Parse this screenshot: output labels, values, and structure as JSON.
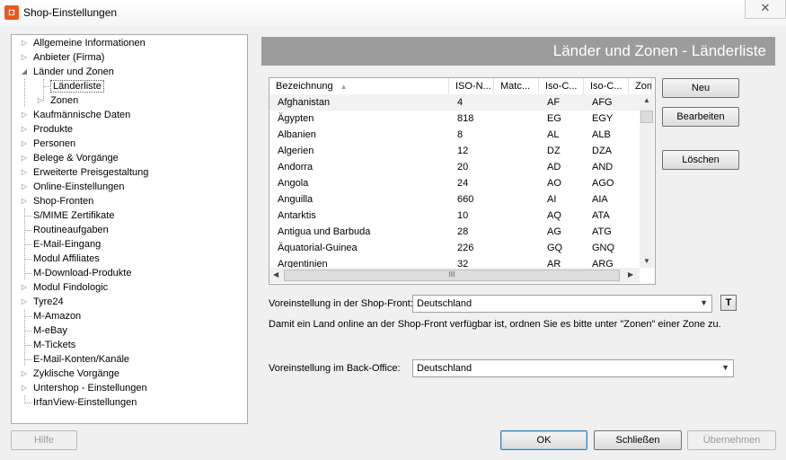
{
  "window": {
    "title": "Shop-Einstellungen",
    "close_glyph": "✕"
  },
  "tree": {
    "items": [
      {
        "label": "Allgemeine Informationen",
        "level": 0,
        "expander": "collapsed"
      },
      {
        "label": "Anbieter (Firma)",
        "level": 0,
        "expander": "collapsed"
      },
      {
        "label": "Länder und Zonen",
        "level": 0,
        "expander": "expanded"
      },
      {
        "label": "Länderliste",
        "level": 1,
        "expander": "none",
        "selected": true
      },
      {
        "label": "Zonen",
        "level": 1,
        "expander": "collapsed"
      },
      {
        "label": "Kaufmännische Daten",
        "level": 0,
        "expander": "collapsed"
      },
      {
        "label": "Produkte",
        "level": 0,
        "expander": "collapsed"
      },
      {
        "label": "Personen",
        "level": 0,
        "expander": "collapsed"
      },
      {
        "label": "Belege & Vorgänge",
        "level": 0,
        "expander": "collapsed"
      },
      {
        "label": "Erweiterte Preisgestaltung",
        "level": 0,
        "expander": "collapsed"
      },
      {
        "label": "Online-Einstellungen",
        "level": 0,
        "expander": "collapsed"
      },
      {
        "label": "Shop-Fronten",
        "level": 0,
        "expander": "collapsed"
      },
      {
        "label": "S/MIME Zertifikate",
        "level": 0,
        "expander": "none"
      },
      {
        "label": "Routineaufgaben",
        "level": 0,
        "expander": "none"
      },
      {
        "label": "E-Mail-Eingang",
        "level": 0,
        "expander": "none"
      },
      {
        "label": "Modul Affiliates",
        "level": 0,
        "expander": "none"
      },
      {
        "label": "M-Download-Produkte",
        "level": 0,
        "expander": "none"
      },
      {
        "label": "Modul Findologic",
        "level": 0,
        "expander": "collapsed"
      },
      {
        "label": "Tyre24",
        "level": 0,
        "expander": "collapsed"
      },
      {
        "label": "M-Amazon",
        "level": 0,
        "expander": "none"
      },
      {
        "label": "M-eBay",
        "level": 0,
        "expander": "none"
      },
      {
        "label": "M-Tickets",
        "level": 0,
        "expander": "none"
      },
      {
        "label": "E-Mail-Konten/Kanäle",
        "level": 0,
        "expander": "none"
      },
      {
        "label": "Zyklische Vorgänge",
        "level": 0,
        "expander": "collapsed"
      },
      {
        "label": "Untershop - Einstellungen",
        "level": 0,
        "expander": "collapsed"
      },
      {
        "label": "IrfanView-Einstellungen",
        "level": 0,
        "expander": "none"
      }
    ]
  },
  "header": {
    "title": "Länder und Zonen - Länderliste"
  },
  "grid": {
    "columns": [
      "Bezeichnung",
      "ISO-N...",
      "Matc...",
      "Iso-C...",
      "Iso-C...",
      "Zon"
    ],
    "sort_glyph": "▲",
    "rows": [
      [
        "Afghanistan",
        "4",
        "",
        "AF",
        "AFG",
        ""
      ],
      [
        "Ägypten",
        "818",
        "",
        "EG",
        "EGY",
        ""
      ],
      [
        "Albanien",
        "8",
        "",
        "AL",
        "ALB",
        ""
      ],
      [
        "Algerien",
        "12",
        "",
        "DZ",
        "DZA",
        ""
      ],
      [
        "Andorra",
        "20",
        "",
        "AD",
        "AND",
        ""
      ],
      [
        "Angola",
        "24",
        "",
        "AO",
        "AGO",
        ""
      ],
      [
        "Anguilla",
        "660",
        "",
        "AI",
        "AIA",
        ""
      ],
      [
        "Antarktis",
        "10",
        "",
        "AQ",
        "ATA",
        ""
      ],
      [
        "Antigua und Barbuda",
        "28",
        "",
        "AG",
        "ATG",
        ""
      ],
      [
        "Äquatorial-Guinea",
        "226",
        "",
        "GQ",
        "GNQ",
        ""
      ],
      [
        "Argentinien",
        "32",
        "",
        "AR",
        "ARG",
        ""
      ]
    ],
    "hscroll_grip": "III"
  },
  "buttons": {
    "new": "Neu",
    "edit": "Bearbeiten",
    "delete": "Löschen",
    "help": "Hilfe",
    "ok": "OK",
    "close": "Schließen",
    "apply": "Übernehmen"
  },
  "shopfront": {
    "label": "Voreinstellung in der Shop-Front:",
    "value": "Deutschland",
    "t_button": "T"
  },
  "info_text": "Damit ein Land online an der Shop-Front verfügbar ist, ordnen Sie es bitte unter \"Zonen\" einer Zone zu.",
  "backoffice": {
    "label": "Voreinstellung im Back-Office:",
    "value": "Deutschland"
  }
}
